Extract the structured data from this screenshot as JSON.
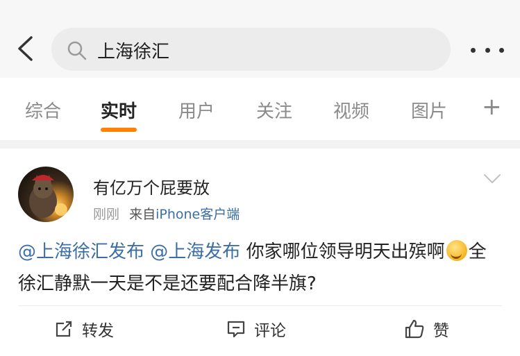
{
  "search": {
    "query": "上海徐汇",
    "icons": {
      "back": "chevron-left-icon",
      "search": "search-icon",
      "more": "more-dots-icon"
    }
  },
  "tabs": [
    {
      "label": "综合",
      "active": false
    },
    {
      "label": "实时",
      "active": true
    },
    {
      "label": "用户",
      "active": false
    },
    {
      "label": "关注",
      "active": false
    },
    {
      "label": "视频",
      "active": false
    },
    {
      "label": "图片",
      "active": false
    }
  ],
  "tab_add_label": "+",
  "colors": {
    "accent": "#ff8200",
    "link": "#3b6ea8"
  },
  "post": {
    "username": "有亿万个屁要放",
    "time": "刚刚",
    "source_prefix": "来自",
    "device": "iPhone客户端",
    "mention1": "@上海徐汇发布",
    "mention2": "@上海发布",
    "text_part1": "你家哪位领导明天出殡啊",
    "emoji": "grin-emoji",
    "text_part2": "全徐汇静默一天是不是还要配合降半旗?",
    "actions": {
      "repost": "转发",
      "comment": "评论",
      "like": "赞"
    }
  }
}
